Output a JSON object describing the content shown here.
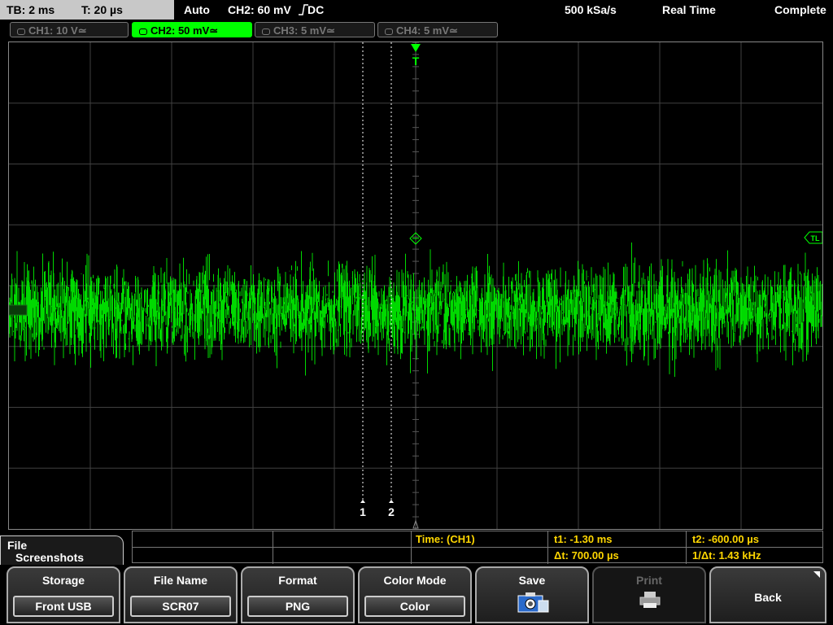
{
  "status_bar": {
    "timebase": "TB: 2 ms",
    "trigger_time": "T: 20 µs",
    "trigger_mode": "Auto",
    "trigger_source": "CH2: 60 mV",
    "trigger_coupling": "DC",
    "sample_rate": "500 kSa/s",
    "acq_mode": "Real Time",
    "acq_status": "Complete"
  },
  "channels": [
    {
      "label": "CH1: 10 V",
      "coupling_icon": "≃",
      "active": false
    },
    {
      "label": "CH2: 50 mV",
      "coupling_icon": "≃",
      "active": true
    },
    {
      "label": "CH3: 5 mV",
      "coupling_icon": "≃",
      "active": false
    },
    {
      "label": "CH4: 5 mV",
      "coupling_icon": "≃",
      "active": false
    }
  ],
  "display": {
    "trace_color": "#00ff00",
    "cursor_color": "#ffffff",
    "grid_color": "#404040",
    "trigger_marker": "T",
    "trigger_level_marker": "TL",
    "cursor1_label": "1",
    "cursor2_label": "2"
  },
  "measurement": {
    "title": "Time:  (CH1)",
    "t1": "t1: -1.30 ms",
    "t2": "t2: -600.00 µs",
    "delta_t": "Δt: 700.00 µs",
    "inv_delta_t": "1/Δt: 1.43 kHz"
  },
  "menu": {
    "path_line1": "File",
    "path_line2": "Screenshots"
  },
  "softkeys": {
    "storage_label": "Storage",
    "storage_value": "Front USB",
    "filename_label": "File Name",
    "filename_value": "SCR07",
    "format_label": "Format",
    "format_value": "PNG",
    "colormode_label": "Color Mode",
    "colormode_value": "Color",
    "save_label": "Save",
    "print_label": "Print",
    "back_label": "Back"
  }
}
